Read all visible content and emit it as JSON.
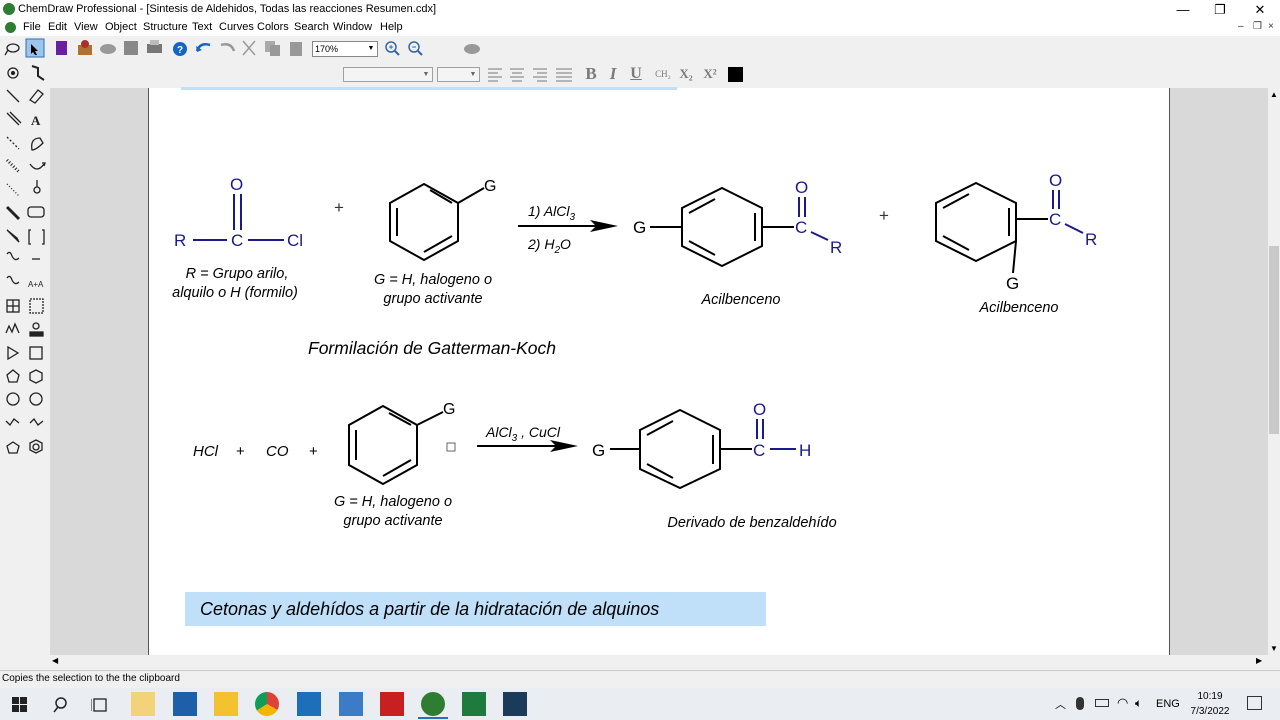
{
  "window": {
    "title": "ChemDraw Professional - [Sintesis de Aldehidos, Todas las reacciones Resumen.cdx]",
    "minimize": "—",
    "restore": "❐",
    "close": "✕"
  },
  "menu": [
    "File",
    "Edit",
    "View",
    "Object",
    "Structure",
    "Text",
    "Curves",
    "Colors",
    "Search",
    "Window",
    "Help"
  ],
  "mdi_controls": [
    "–",
    "❐",
    "×"
  ],
  "toolbar": {
    "zoom_value": "170%",
    "format": {
      "bold": "B",
      "italic": "I",
      "underline": "U",
      "chem": "CH₂",
      "subscript": "X₂",
      "superscript": "X²"
    }
  },
  "palette": {
    "text_tool": "A",
    "increase_text": "A+A"
  },
  "document": {
    "colors": {
      "atom_blue": "#1a1a8c",
      "highlight_blue": "#bfe0f8"
    },
    "reaction1": {
      "acyl_chloride": {
        "O": "O",
        "R": "R",
        "C": "C",
        "Cl": "Cl"
      },
      "r_note_line1": "R = Grupo arilo,",
      "r_note_line2": "alquilo o H (formilo)",
      "plus": "+",
      "benzene_g": "G",
      "g_note_line1": "G = H, halogeno o",
      "g_note_line2": "grupo activante",
      "cond_top": "1) AlCl",
      "cond_top_sub": "3",
      "cond_bottom": "2) H",
      "cond_bottom_sub": "2",
      "cond_bottom_end": "O",
      "product1": {
        "G": "G",
        "C": "C",
        "O": "O",
        "R": "R"
      },
      "product1_label": "Acilbenceno",
      "plus2": "+",
      "product2": {
        "G": "G",
        "C": "C",
        "O": "O",
        "R": "R"
      },
      "product2_label": "Acilbenceno"
    },
    "section_title": "Formilación de Gatterman-Koch",
    "reaction2": {
      "hcl": "HCl",
      "plus_a": "+",
      "co": "CO",
      "plus_b": "+",
      "benzene_g": "G",
      "g_note_line1": "G = H, halogeno o",
      "g_note_line2": "grupo activante",
      "cond": "AlCl",
      "cond_sub": "3",
      "cond_end": " , CuCl",
      "product": {
        "G": "G",
        "C": "C",
        "O": "O",
        "H": "H"
      },
      "product_label": "Derivado de benzaldehído"
    },
    "banner": "Cetonas y aldehídos a partir de la hidratación de alquinos"
  },
  "status": "Copies the selection to the the clipboard",
  "taskbar": {
    "lang": "ENG",
    "time": "10:19",
    "date": "7/3/2022"
  }
}
